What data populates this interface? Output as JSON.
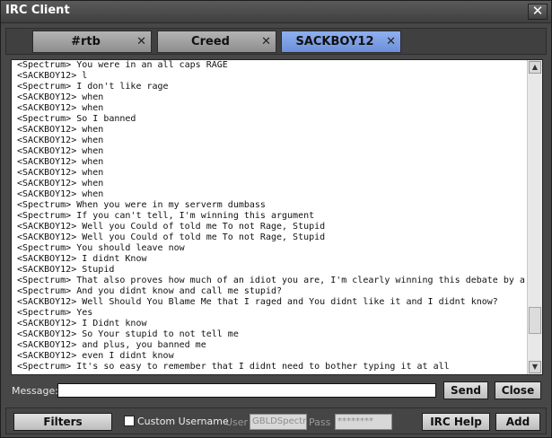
{
  "window": {
    "title": "IRC Client"
  },
  "tabs": [
    {
      "label": "#rtb",
      "close": "✕",
      "active": false
    },
    {
      "label": "Creed",
      "close": "✕",
      "active": false
    },
    {
      "label": "SACKBOY12",
      "close": "✕",
      "active": true
    }
  ],
  "chat": {
    "lines": [
      "<Spectrum> You were in an all caps RAGE",
      "<SACKBOY12> l",
      "<Spectrum> I don't like rage",
      "<SACKBOY12> when",
      "<SACKBOY12> when",
      "<Spectrum> So I banned",
      "<SACKBOY12> when",
      "<SACKBOY12> when",
      "<SACKBOY12> when",
      "<SACKBOY12> when",
      "<SACKBOY12> when",
      "<SACKBOY12> when",
      "<SACKBOY12> when",
      "<Spectrum> When you were in my serverm dumbass",
      "<Spectrum> If you can't tell, I'm winning this argument",
      "<SACKBOY12> Well you Could of told me To not Rage, Stupid",
      "<SACKBOY12> Well you Could of told me To not Rage, Stupid",
      "<Spectrum> You should leave now",
      "<SACKBOY12> I didnt Know",
      "<SACKBOY12> Stupid",
      "<Spectrum> That also proves how much of an idiot you are, I'm clearly winning this debate by a landslide",
      "<Spectrum> And you didnt know and call me stupid?",
      "<SACKBOY12> Well Should You Blame Me that I raged and You didnt like it and I didnt know?",
      "<Spectrum> Yes",
      "<SACKBOY12> I Didnt know",
      "<SACKBOY12> So Your stupid to not tell me",
      "<SACKBOY12> and plus, you banned me",
      "<SACKBOY12> even I didnt know",
      "<Spectrum> It's so easy to remember that I didnt need to bother typing it at all"
    ],
    "scroll_up_icon": "triangle-up",
    "scroll_down_icon": "triangle-down",
    "scroll_position": 0.9
  },
  "message": {
    "label": "Message:",
    "value": "",
    "send_label": "Send",
    "close_label": "Close"
  },
  "bottom": {
    "filters_label": "Filters",
    "custom_username_label": "Custom Username",
    "custom_username_checked": false,
    "user_label": "User",
    "user_value": "GBLDSpectr",
    "pass_label": "Pass",
    "pass_value": "********",
    "irc_help_label": "IRC Help",
    "add_label": "Add"
  }
}
